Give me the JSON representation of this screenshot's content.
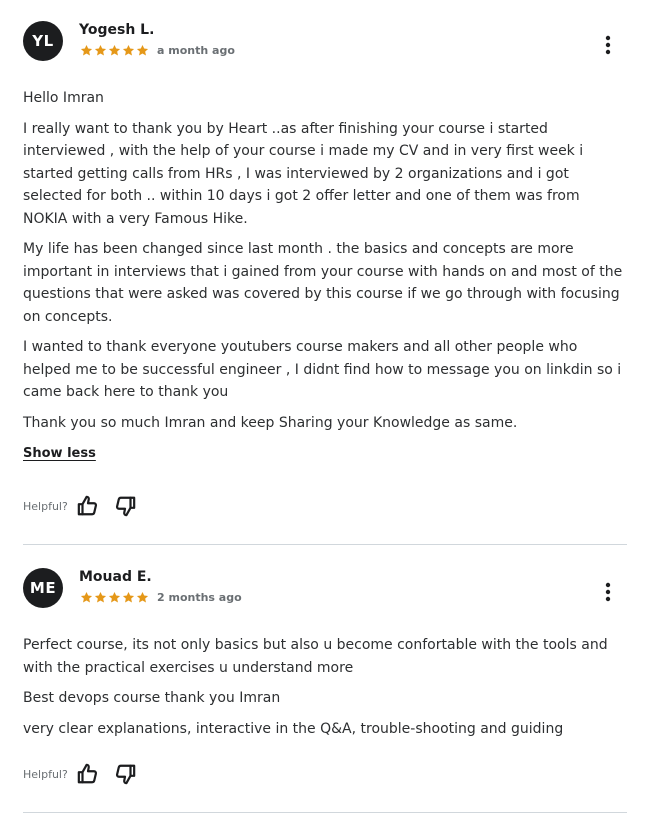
{
  "reviews": [
    {
      "initials": "YL",
      "name": "Yogesh L.",
      "rating": 5,
      "date": "a month ago",
      "paragraphs": [
        "Hello Imran",
        "I really want to thank you by Heart ..as after finishing your course i started interviewed , with the help of your course i made my CV and in very first week i started getting calls from HRs , I was interviewed by 2 organizations and i got selected for both .. within 10 days i got 2 offer letter and one of them was from NOKIA with a very Famous Hike.",
        "My life has been changed since last month . the basics and concepts are more important in interviews that i gained from your course with hands on and most of the questions that were asked was covered by this course if we go through with focusing on concepts.",
        "I wanted to thank everyone youtubers course makers and all other people who helped me to be successful engineer , I didnt find how to message you on linkdin so i came back here to thank you",
        "Thank you so much Imran and keep Sharing your Knowledge as same."
      ],
      "show_less_label": "Show less",
      "helpful_label": "Helpful?"
    },
    {
      "initials": "ME",
      "name": "Mouad E.",
      "rating": 5,
      "date": "2 months ago",
      "paragraphs": [
        "Perfect course, its not only basics but also u become confortable with the tools and with the practical exercises u understand more",
        "Best devops course thank you Imran",
        "very clear explanations, interactive in the Q&A, trouble-shooting and guiding"
      ],
      "helpful_label": "Helpful?"
    }
  ],
  "icons": {
    "star": "star-icon",
    "more": "more-vertical-icon",
    "thumbs_up": "thumbs-up-icon",
    "thumbs_down": "thumbs-down-icon"
  },
  "colors": {
    "star": "#e59819",
    "avatar_bg": "#1c1d1f",
    "text": "#2d2f31",
    "muted": "#6a6f73",
    "divider": "#d1d7dc"
  }
}
